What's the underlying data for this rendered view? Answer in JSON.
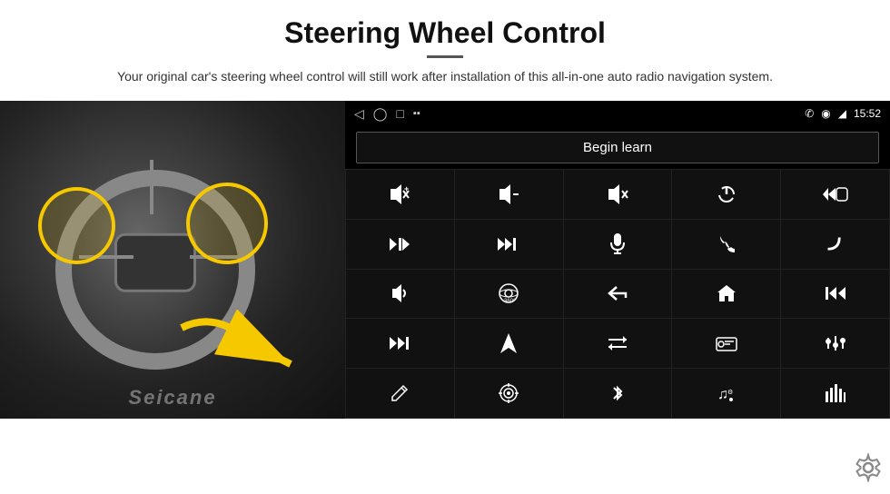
{
  "header": {
    "title": "Steering Wheel Control",
    "subtitle": "Your original car's steering wheel control will still work after installation of this all-in-one auto radio navigation system."
  },
  "status_bar": {
    "back_icon": "◁",
    "home_icon": "□",
    "overview_icon": "▭",
    "signal_icon": "▪▪",
    "phone_icon": "📞",
    "location_icon": "⌖",
    "wifi_icon": "▾",
    "time": "15:52"
  },
  "begin_learn": {
    "label": "Begin learn"
  },
  "controls": [
    {
      "icon": "🔊+",
      "label": "vol-up"
    },
    {
      "icon": "🔊-",
      "label": "vol-down"
    },
    {
      "icon": "🔇",
      "label": "mute"
    },
    {
      "icon": "⏻",
      "label": "power"
    },
    {
      "icon": "⏮",
      "label": "prev-track-phone"
    },
    {
      "icon": "⏭",
      "label": "next"
    },
    {
      "icon": "⏭⏭",
      "label": "fast-forward"
    },
    {
      "icon": "🎙",
      "label": "mic"
    },
    {
      "icon": "📞",
      "label": "call"
    },
    {
      "icon": "📵",
      "label": "end-call"
    },
    {
      "icon": "📣",
      "label": "horn"
    },
    {
      "icon": "🔄",
      "label": "360"
    },
    {
      "icon": "↩",
      "label": "back"
    },
    {
      "icon": "🏠",
      "label": "home"
    },
    {
      "icon": "⏮⏮",
      "label": "prev-track"
    },
    {
      "icon": "⏭",
      "label": "skip"
    },
    {
      "icon": "▶",
      "label": "nav"
    },
    {
      "icon": "⇌",
      "label": "switch"
    },
    {
      "icon": "📻",
      "label": "radio"
    },
    {
      "icon": "🎚",
      "label": "eq"
    },
    {
      "icon": "✏",
      "label": "pen"
    },
    {
      "icon": "⊙",
      "label": "target"
    },
    {
      "icon": "✱",
      "label": "bluetooth"
    },
    {
      "icon": "🎵",
      "label": "music"
    },
    {
      "icon": "📊",
      "label": "spectrum"
    }
  ],
  "watermark": "Seicane",
  "settings": {
    "icon_label": "gear-icon"
  }
}
